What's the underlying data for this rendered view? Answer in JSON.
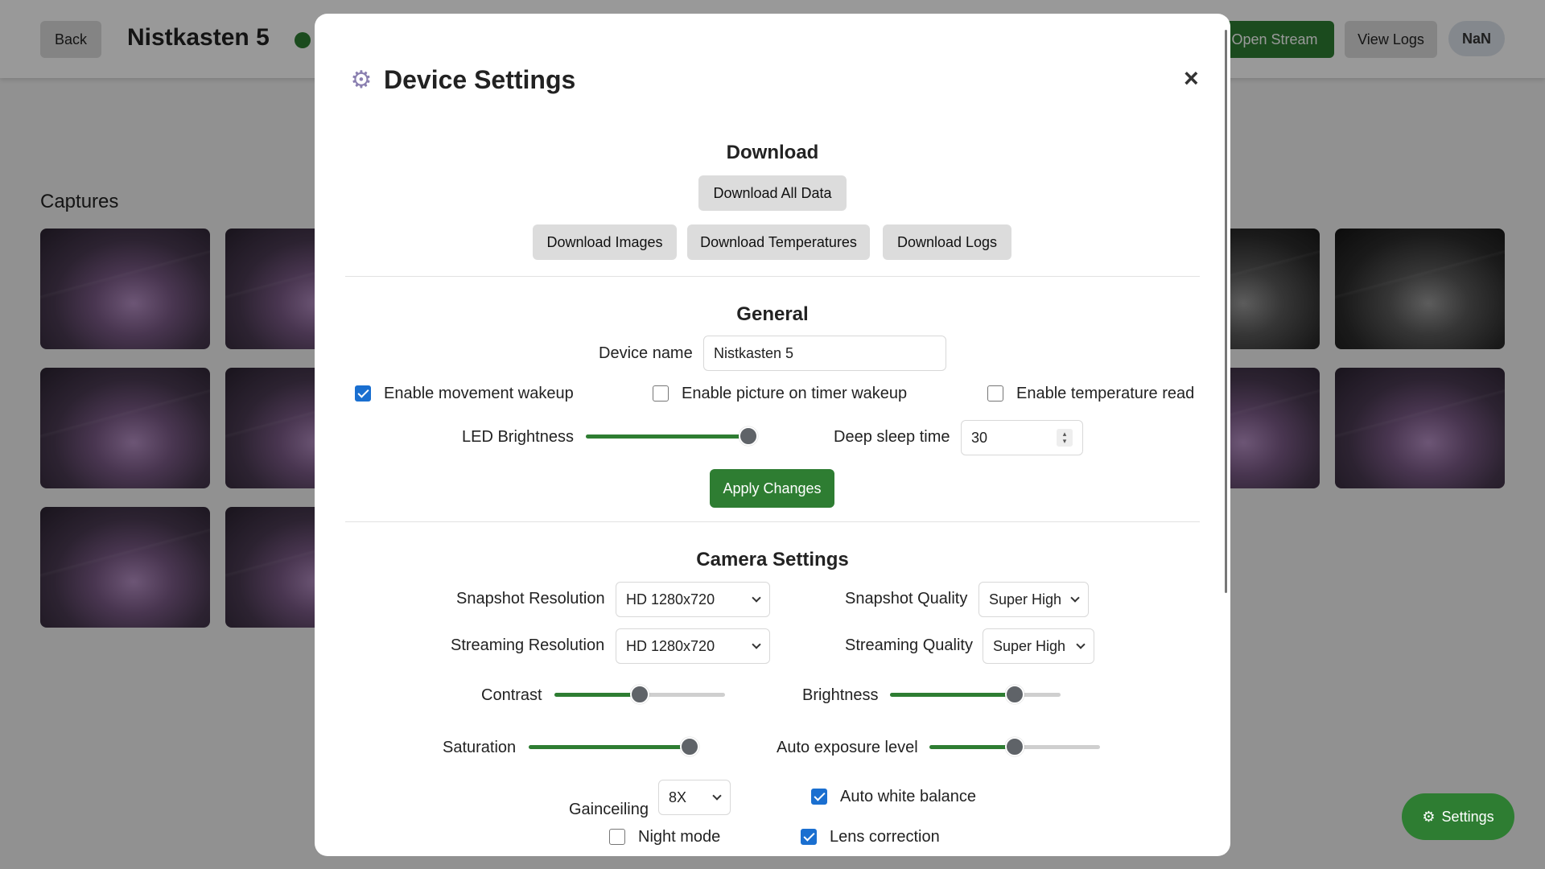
{
  "header": {
    "back_label": "Back",
    "device_title": "Nistkasten 5",
    "open_stream_label": "Open Stream",
    "view_logs_label": "View Logs",
    "status_badge": "NaN"
  },
  "captures": {
    "title": "Captures"
  },
  "fab": {
    "settings_label": "Settings"
  },
  "modal": {
    "title": "Device Settings",
    "close_symbol": "×",
    "download": {
      "title": "Download",
      "all_label": "Download All Data",
      "images_label": "Download Images",
      "temperatures_label": "Download Temperatures",
      "logs_label": "Download Logs"
    },
    "general": {
      "title": "General",
      "device_name_label": "Device name",
      "device_name_value": "Nistkasten 5",
      "movement_wakeup_label": "Enable movement wakeup",
      "movement_wakeup_checked": true,
      "timer_wakeup_label": "Enable picture on timer wakeup",
      "timer_wakeup_checked": false,
      "temperature_read_label": "Enable temperature read",
      "temperature_read_checked": false,
      "led_brightness_label": "LED Brightness",
      "led_brightness_value": 1.0,
      "deep_sleep_label": "Deep sleep time",
      "deep_sleep_value": "30",
      "apply_label": "Apply Changes"
    },
    "camera": {
      "title": "Camera Settings",
      "snapshot_resolution_label": "Snapshot Resolution",
      "snapshot_resolution_value": "HD 1280x720",
      "snapshot_quality_label": "Snapshot Quality",
      "snapshot_quality_value": "Super High",
      "streaming_resolution_label": "Streaming Resolution",
      "streaming_resolution_value": "HD 1280x720",
      "streaming_quality_label": "Streaming Quality",
      "streaming_quality_value": "Super High",
      "contrast_label": "Contrast",
      "contrast_value": 0.5,
      "brightness_label": "Brightness",
      "brightness_value": 0.73,
      "saturation_label": "Saturation",
      "saturation_value": 1.0,
      "auto_exposure_label": "Auto exposure level",
      "auto_exposure_value": 0.5,
      "gainceiling_label": "Gainceiling",
      "gainceiling_value": "8X",
      "auto_white_balance_label": "Auto white balance",
      "auto_white_balance_checked": true,
      "night_mode_label": "Night mode",
      "night_mode_checked": false,
      "lens_correction_label": "Lens correction",
      "lens_correction_checked": true
    }
  },
  "colors": {
    "accent_green": "#2e7d32",
    "checkbox_blue": "#1a6fd0"
  }
}
